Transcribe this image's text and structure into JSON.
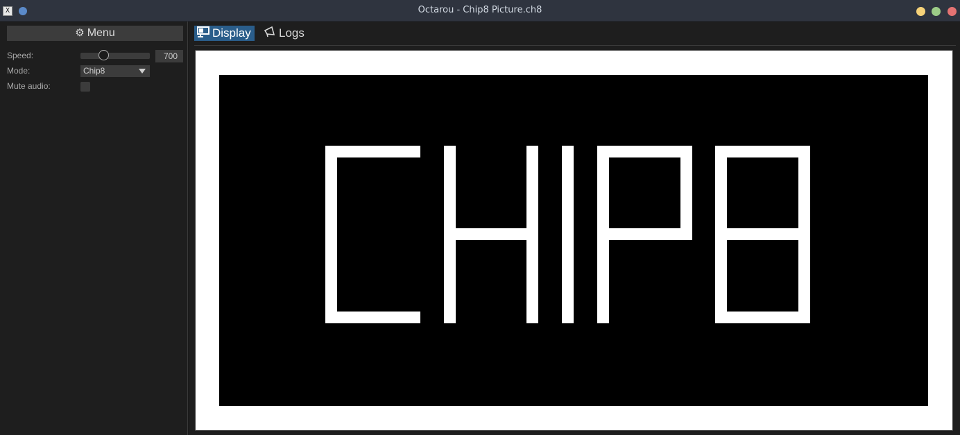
{
  "window": {
    "title": "Octarou - Chip8 Picture.ch8",
    "app_icon_glyph": "X"
  },
  "sidebar": {
    "menu_label": "Menu",
    "menu_icon": "gear-icon",
    "speed_label": "Speed:",
    "speed_value": "700",
    "speed_slider_fraction": 0.33,
    "mode_label": "Mode:",
    "mode_value": "Chip8",
    "mute_label": "Mute audio:",
    "mute_checked": false
  },
  "tabs": [
    {
      "label": "Display",
      "icon": "monitor-icon",
      "active": true
    },
    {
      "label": "Logs",
      "icon": "megaphone-icon",
      "active": false
    }
  ],
  "display": {
    "content": "CHIP8",
    "foreground": "#ffffff",
    "background": "#000000",
    "border_color": "#ffffff"
  },
  "colors": {
    "titlebar": "#2f343f",
    "panel": "#1e1e1e",
    "accent": "#2a5d8a",
    "control": "#3c3c3c"
  }
}
